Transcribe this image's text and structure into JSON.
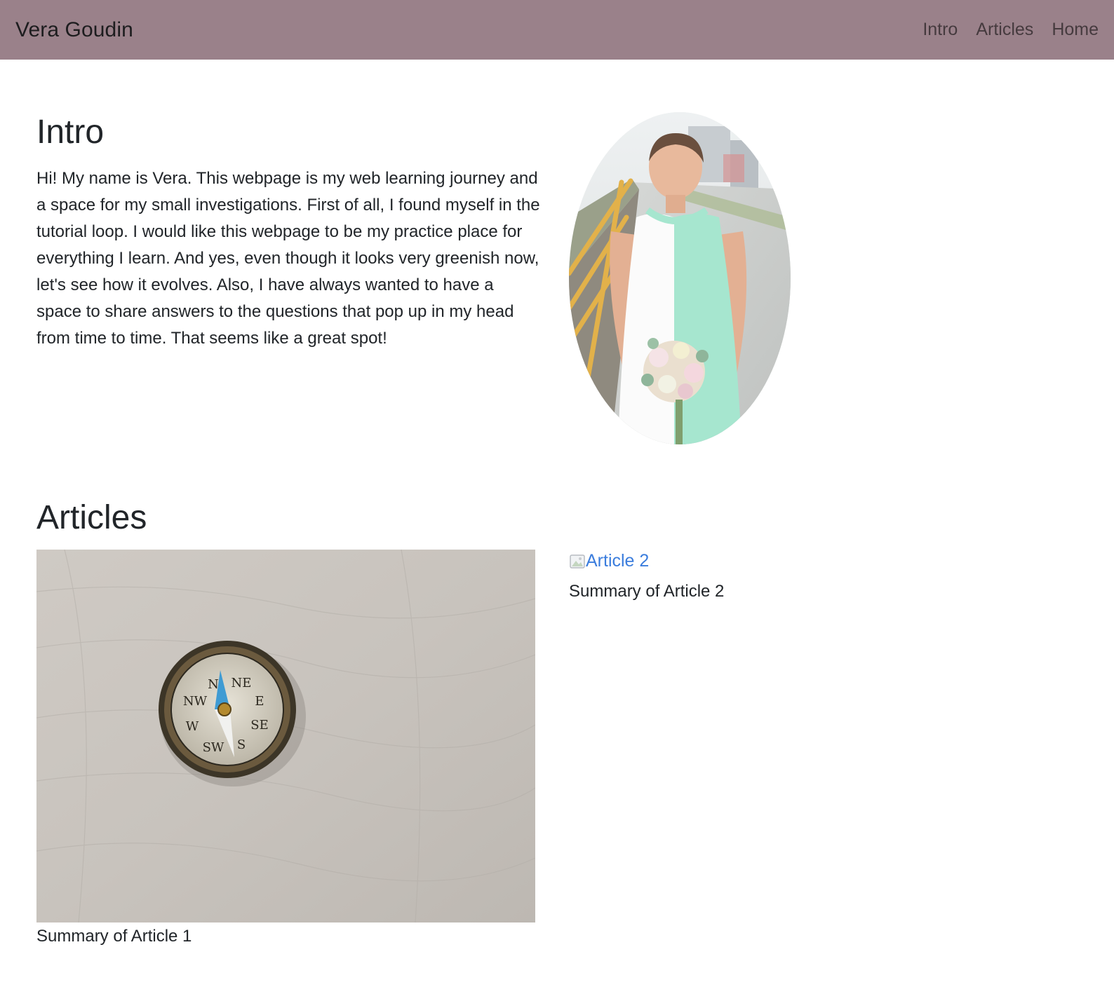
{
  "navbar": {
    "brand": "Vera Goudin",
    "links": [
      "Intro",
      "Articles",
      "Home"
    ],
    "background_color": "#9a818a"
  },
  "intro": {
    "title": "Intro",
    "text": "Hi! My name is Vera. This webpage is my web learning journey and a space for my small investigations. First of all, I found myself in the tutorial loop. I would like this webpage to be my practice place for everything I learn. And yes, even though it looks very greenish now, let's see how it evolves. Also, I have always wanted to have a space to share answers to the questions that pop up in my head from time to time. That seems like a great spot!"
  },
  "articles": {
    "title": "Articles",
    "items": [
      {
        "summary": "Summary of Article 1"
      },
      {
        "image_alt": "Article 2",
        "summary": "Summary of Article 2",
        "link_color": "#3b7ddd"
      }
    ]
  }
}
